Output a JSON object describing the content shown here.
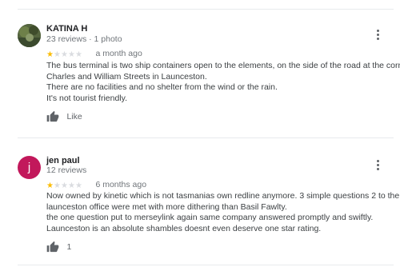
{
  "reviews": [
    {
      "name": "KATINA H",
      "meta": "23 reviews · 1 photo",
      "rating": 1,
      "time": "a month ago",
      "lines": [
        "The bus terminal is two ship containers open to the elements, on the side of the road at the corner of",
        "Charles and William Streets in Launceston.",
        "There are no facilities and no shelter from the wind or the rain.",
        "It's not tourist friendly."
      ],
      "like_label": "Like"
    },
    {
      "name": "jen paul",
      "avatar_letter": "j",
      "meta": "12 reviews",
      "rating": 1,
      "time": "6 months ago",
      "lines": [
        "Now owned by kinetic which is not tasmanias own redline anymore.  3 simple questions 2 to the",
        "launceston office were met with more dithering than Basil Fawlty.",
        "the one question put to merseylink again same company answered promptly and swiftly.",
        "Launceston is an absolute shambles doesnt even deserve one star rating."
      ],
      "like_label": "1"
    }
  ],
  "colors": {
    "star_on": "#fbbc04",
    "star_off": "#dadce0",
    "avatar_j": "#c2185b"
  },
  "icons": [
    "more-vert-icon",
    "thumb-up-icon",
    "star-icon"
  ]
}
